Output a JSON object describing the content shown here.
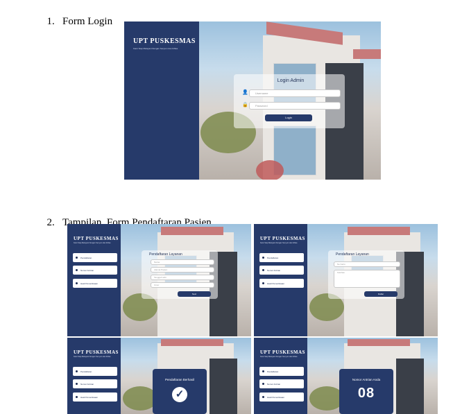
{
  "sections": [
    {
      "number": "1.",
      "title": "Form Login"
    },
    {
      "number": "2.",
      "title": "Tampilan  Form Pendaftaran Pasien"
    }
  ],
  "brand": {
    "name": "UPT PUSKESMAS",
    "tagline": "Kami Siap Melayani Dengan Senyum dan Ikhlas"
  },
  "login": {
    "title": "Login Admin",
    "username_placeholder": "Username",
    "password_placeholder": "Password",
    "button": "Login"
  },
  "menu": [
    "Pendaftaran",
    "Nomor Antrian",
    "Hasil Pemeriksaan"
  ],
  "form1": {
    "title": "Pendaftaran Layanan",
    "fields": [
      "Nama",
      "Alamat Pasien",
      "Tanggal Lahir",
      "Umur"
    ],
    "button": "Next"
  },
  "form2": {
    "title": "Pendaftaran Layanan",
    "fields": [
      "No Kartu",
      "Keluhan"
    ],
    "button": "Daftar"
  },
  "success": {
    "title": "Pendaftaran Berhasil",
    "icon": "check-circle-icon"
  },
  "queue": {
    "title": "Nomor Antrian Anda",
    "number": "08"
  }
}
